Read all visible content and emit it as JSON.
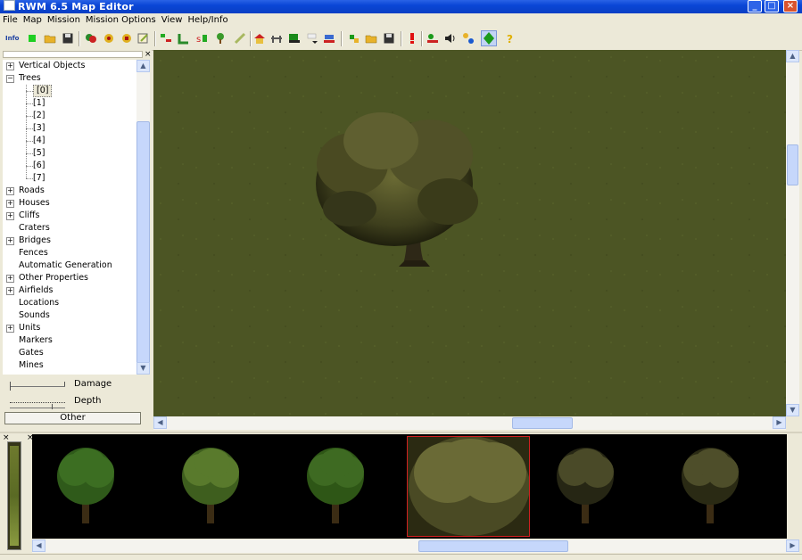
{
  "window": {
    "title": "RWM 6.5 Map Editor"
  },
  "menu": [
    "File",
    "Map",
    "Mission",
    "Mission Options",
    "View",
    "Help/Info"
  ],
  "toolbar": {
    "info_label": "Info",
    "icons": [
      "info-icon",
      "new-icon",
      "open-folder-icon",
      "save-icon",
      "tool-icon",
      "tool-icon",
      "tool-icon",
      "tool-icon",
      "tool-icon",
      "tool-icon",
      "tool-icon",
      "tree-icon",
      "tool-icon",
      "house-icon",
      "fence-icon",
      "tool-icon",
      "tool-icon",
      "tool-icon",
      "tool-icon",
      "open-folder-icon",
      "save-icon",
      "alert-icon",
      "tool-icon",
      "sound-icon",
      "tool-icon",
      "tool-icon",
      "help-icon"
    ]
  },
  "tree": {
    "items": [
      {
        "label": "Vertical Objects",
        "expander": "+"
      },
      {
        "label": "Trees",
        "expander": "−"
      },
      {
        "label": "[0]",
        "child": true,
        "selected": true
      },
      {
        "label": "[1]",
        "child": true
      },
      {
        "label": "[2]",
        "child": true
      },
      {
        "label": "[3]",
        "child": true
      },
      {
        "label": "[4]",
        "child": true
      },
      {
        "label": "[5]",
        "child": true
      },
      {
        "label": "[6]",
        "child": true
      },
      {
        "label": "[7]",
        "child": true
      },
      {
        "label": "Roads",
        "expander": "+"
      },
      {
        "label": "Houses",
        "expander": "+"
      },
      {
        "label": "Cliffs",
        "expander": "+"
      },
      {
        "label": "Craters"
      },
      {
        "label": "Bridges",
        "expander": "+"
      },
      {
        "label": "Fences"
      },
      {
        "label": "Automatic Generation"
      },
      {
        "label": "Other Properties",
        "expander": "+"
      },
      {
        "label": "Airfields",
        "expander": "+"
      },
      {
        "label": "Locations"
      },
      {
        "label": "Sounds"
      },
      {
        "label": "Units",
        "expander": "+"
      },
      {
        "label": "Markers"
      },
      {
        "label": "Gates"
      },
      {
        "label": "Mines"
      }
    ]
  },
  "controls": {
    "damage_label": "Damage",
    "depth_label": "Depth",
    "other_button": "Other"
  },
  "thumbnails": {
    "count": 7,
    "selected_index": 3
  },
  "colors": {
    "titlebar": "#0a46d6",
    "grass": "#4c5524",
    "selection": "#d02020"
  }
}
